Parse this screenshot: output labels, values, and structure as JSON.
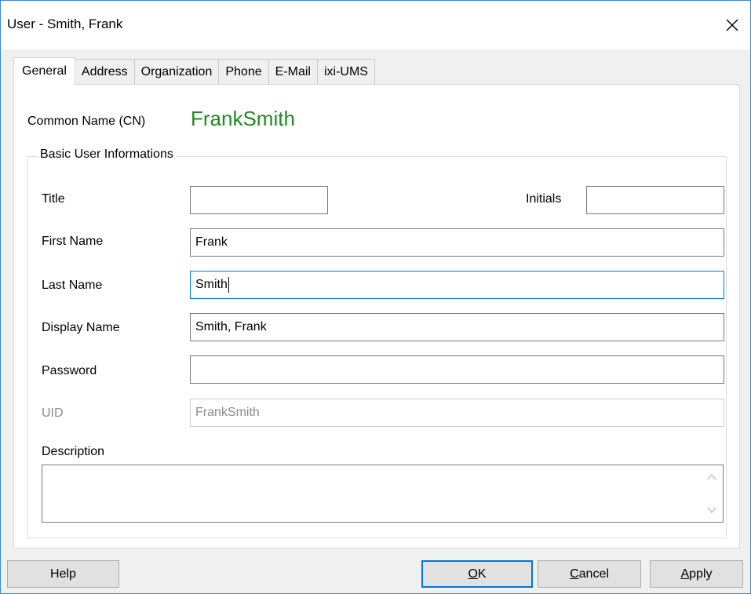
{
  "window": {
    "title": "User - Smith, Frank"
  },
  "tabs": [
    {
      "label": "General",
      "active": true
    },
    {
      "label": "Address"
    },
    {
      "label": "Organization"
    },
    {
      "label": "Phone"
    },
    {
      "label": "E-Mail"
    },
    {
      "label": "ixi-UMS"
    }
  ],
  "general": {
    "cn_label": "Common Name (CN)",
    "cn_value": "FrankSmith",
    "group_title": "Basic User Informations",
    "fields": {
      "title": {
        "label": "Title",
        "value": ""
      },
      "initials": {
        "label": "Initials",
        "value": ""
      },
      "first_name": {
        "label": "First Name",
        "value": "Frank"
      },
      "last_name": {
        "label": "Last Name",
        "value": "Smith"
      },
      "display_name": {
        "label": "Display Name",
        "value": "Smith, Frank"
      },
      "password": {
        "label": "Password",
        "value": ""
      },
      "uid": {
        "label": "UID",
        "value": "FrankSmith"
      },
      "description": {
        "label": "Description",
        "value": ""
      }
    }
  },
  "buttons": {
    "help": "Help",
    "ok_mnemonic": "O",
    "ok_rest": "K",
    "cancel_mnemonic": "C",
    "cancel_rest": "ancel",
    "apply_mnemonic": "A",
    "apply_rest": "pply"
  },
  "colors": {
    "cn_value": "#1f8a1f",
    "focus_border": "#0078d7",
    "window_border": "#3c8ad6"
  }
}
